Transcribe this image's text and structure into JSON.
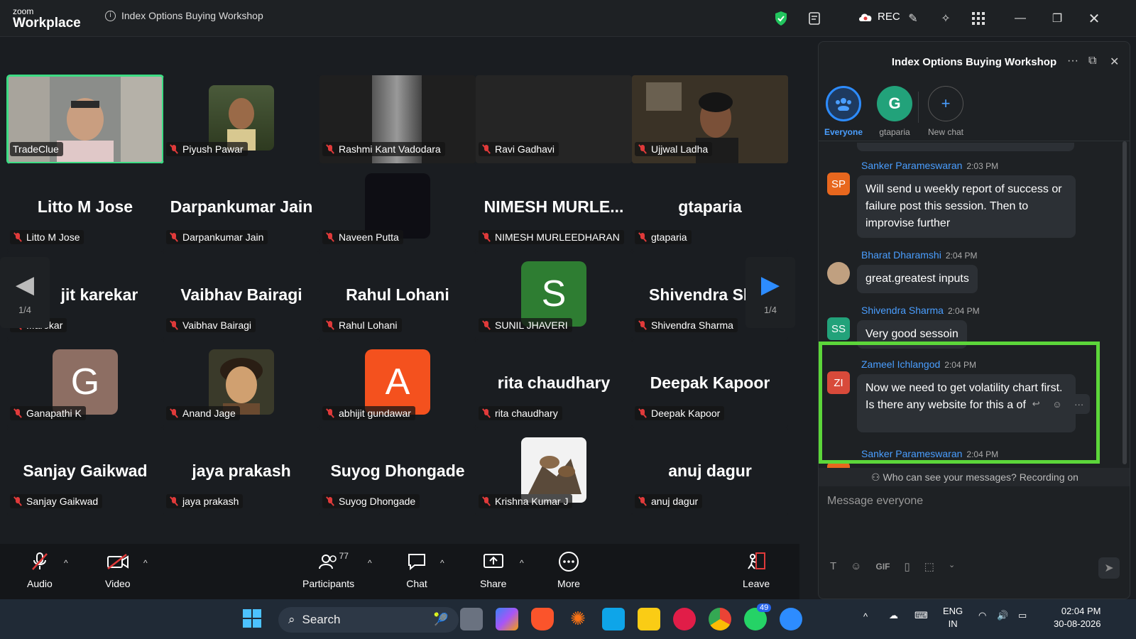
{
  "window": {
    "logo_small": "zoom",
    "logo_big": "Workplace",
    "meeting_title": "Index Options Buying Workshop",
    "rec_label": "REC"
  },
  "gallery": {
    "page_indicator_left": "1/4",
    "page_indicator_right": "1/4",
    "tiles": [
      {
        "display": "",
        "label": "TradeClue",
        "type": "video"
      },
      {
        "display": "",
        "label": "Piyush Pawar",
        "type": "photo"
      },
      {
        "display": "",
        "label": "Rashmi Kant Vadodara",
        "type": "video"
      },
      {
        "display": "",
        "label": "Ravi Gadhavi",
        "type": "video"
      },
      {
        "display": "",
        "label": "Ujjwal Ladha",
        "type": "video"
      },
      {
        "display": "Litto M Jose",
        "label": "Litto M Jose",
        "type": "name"
      },
      {
        "display": "Darpankumar Jain",
        "label": "Darpankumar Jain",
        "type": "name"
      },
      {
        "display": "",
        "label": "Naveen Putta",
        "type": "dark"
      },
      {
        "display": "NIMESH  MURLE...",
        "label": "NIMESH MURLEEDHARAN",
        "type": "name"
      },
      {
        "display": "gtaparia",
        "label": "gtaparia",
        "type": "name"
      },
      {
        "display": "jit karekar",
        "label": "...arekar",
        "type": "name"
      },
      {
        "display": "Vaibhav Bairagi",
        "label": "Vaibhav Bairagi",
        "type": "name"
      },
      {
        "display": "Rahul Lohani",
        "label": "Rahul Lohani",
        "type": "name"
      },
      {
        "display": "S",
        "label": "SUNIL JHAVERI",
        "type": "letter"
      },
      {
        "display": "Shivendra Sha",
        "label": "Shivendra Sharma",
        "type": "name"
      },
      {
        "display": "G",
        "label": "Ganapathi K",
        "type": "letter"
      },
      {
        "display": "",
        "label": "Anand Jage",
        "type": "photo"
      },
      {
        "display": "A",
        "label": "abhijit gundawar",
        "type": "letter"
      },
      {
        "display": "rita chaudhary",
        "label": "rita chaudhary",
        "type": "name"
      },
      {
        "display": "Deepak Kapoor",
        "label": "Deepak Kapoor",
        "type": "name"
      },
      {
        "display": "Sanjay Gaikwad",
        "label": "Sanjay Gaikwad",
        "type": "name"
      },
      {
        "display": "jaya prakash",
        "label": "jaya prakash",
        "type": "name"
      },
      {
        "display": "Suyog Dhongade",
        "label": "Suyog Dhongade",
        "type": "name"
      },
      {
        "display": "",
        "label": "Krishna Kumar J",
        "type": "photo"
      },
      {
        "display": "anuj dagur",
        "label": "anuj dagur",
        "type": "name"
      }
    ]
  },
  "toolbar": {
    "audio": "Audio",
    "video": "Video",
    "participants": "Participants",
    "participants_count": "77",
    "chat": "Chat",
    "share": "Share",
    "more": "More",
    "leave": "Leave"
  },
  "chat": {
    "title": "Index Options Buying Workshop",
    "conversations": [
      {
        "label": "Everyone",
        "initial": ""
      },
      {
        "label": "gtaparia",
        "initial": "G"
      },
      {
        "label": "New chat",
        "initial": "+"
      }
    ],
    "messages": [
      {
        "sender": "Sanker Parameswaran",
        "time": "2:03 PM",
        "initials": "SP",
        "text": "Will send u weekly report of success or failure post this session. Then to improvise further"
      },
      {
        "sender": "Bharat Dharamshi",
        "time": "2:04 PM",
        "initials": "",
        "text": "great.greatest inputs"
      },
      {
        "sender": "Shivendra Sharma",
        "time": "2:04 PM",
        "initials": "SS",
        "text": "Very good sessoin"
      },
      {
        "sender": "Zameel Ichlangod",
        "time": "2:04 PM",
        "initials": "ZI",
        "text": "Now we need to get volatility chart first.  Is there any website for this a of now?"
      },
      {
        "sender": "Sanker Parameswaran",
        "time": "2:04 PM",
        "initials": "",
        "text": ""
      }
    ],
    "privacy_notice": "Who can see your messages? Recording on",
    "input_placeholder": "Message everyone",
    "gif_label": "GIF"
  },
  "taskbar": {
    "search_placeholder": "Search",
    "whatsapp_badge": "49",
    "lang_top": "ENG",
    "lang_bottom": "IN",
    "time": "02:04 PM",
    "date": "30-08-2026"
  }
}
